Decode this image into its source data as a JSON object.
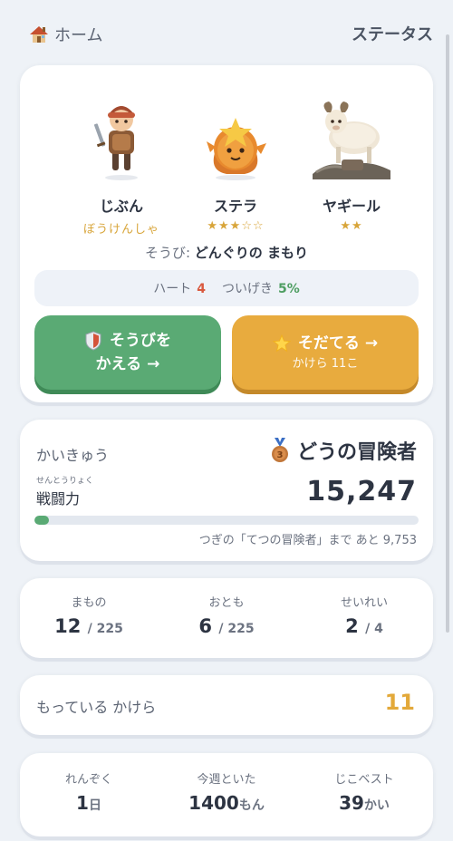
{
  "header": {
    "home_label": "ホーム",
    "title": "ステータス"
  },
  "party": {
    "members": [
      {
        "name": "じぶん",
        "rank": "ぼうけんしゃ"
      },
      {
        "name": "ステラ",
        "rank": "★★★☆☆"
      },
      {
        "name": "ヤギール",
        "rank": "★★"
      }
    ],
    "equip_prefix": "そうび:",
    "equip_value": "どんぐりの まもり",
    "heart_label": "ハート",
    "heart_value": "4",
    "attack_label": "ついげき",
    "attack_value": "5%",
    "equip_button_line1": "そうびを",
    "equip_button_line2": "かえる →",
    "raise_button_label": "そだてる →",
    "raise_button_sub": "かけら 11こ"
  },
  "rank": {
    "label": "かいきゅう",
    "title": "どうの冒険者",
    "power_ruby": "せんとうりょく",
    "power_label": "戦闘力",
    "power_value": "15,247",
    "progress_fraction": 0.037,
    "next_text": "つぎの「てつの冒険者」まで あと 9,753"
  },
  "collection": [
    {
      "label": "まもの",
      "value": "12",
      "total": "/ 225"
    },
    {
      "label": "おとも",
      "value": "6",
      "total": "/ 225"
    },
    {
      "label": "せいれい",
      "value": "2",
      "total": "/ 4"
    }
  ],
  "coins": {
    "label": "もっている かけら",
    "value": "11"
  },
  "streak": [
    {
      "label": "れんぞく",
      "value": "1",
      "unit": "日"
    },
    {
      "label": "今週といた",
      "value": "1400",
      "unit": "もん"
    },
    {
      "label": "じこベスト",
      "value": "39",
      "unit": "かい"
    }
  ],
  "colors": {
    "accent_green": "#5aaa74",
    "accent_orange": "#e8ab3e",
    "heart_red": "#d9593f",
    "star_gold": "#d8a53a"
  }
}
